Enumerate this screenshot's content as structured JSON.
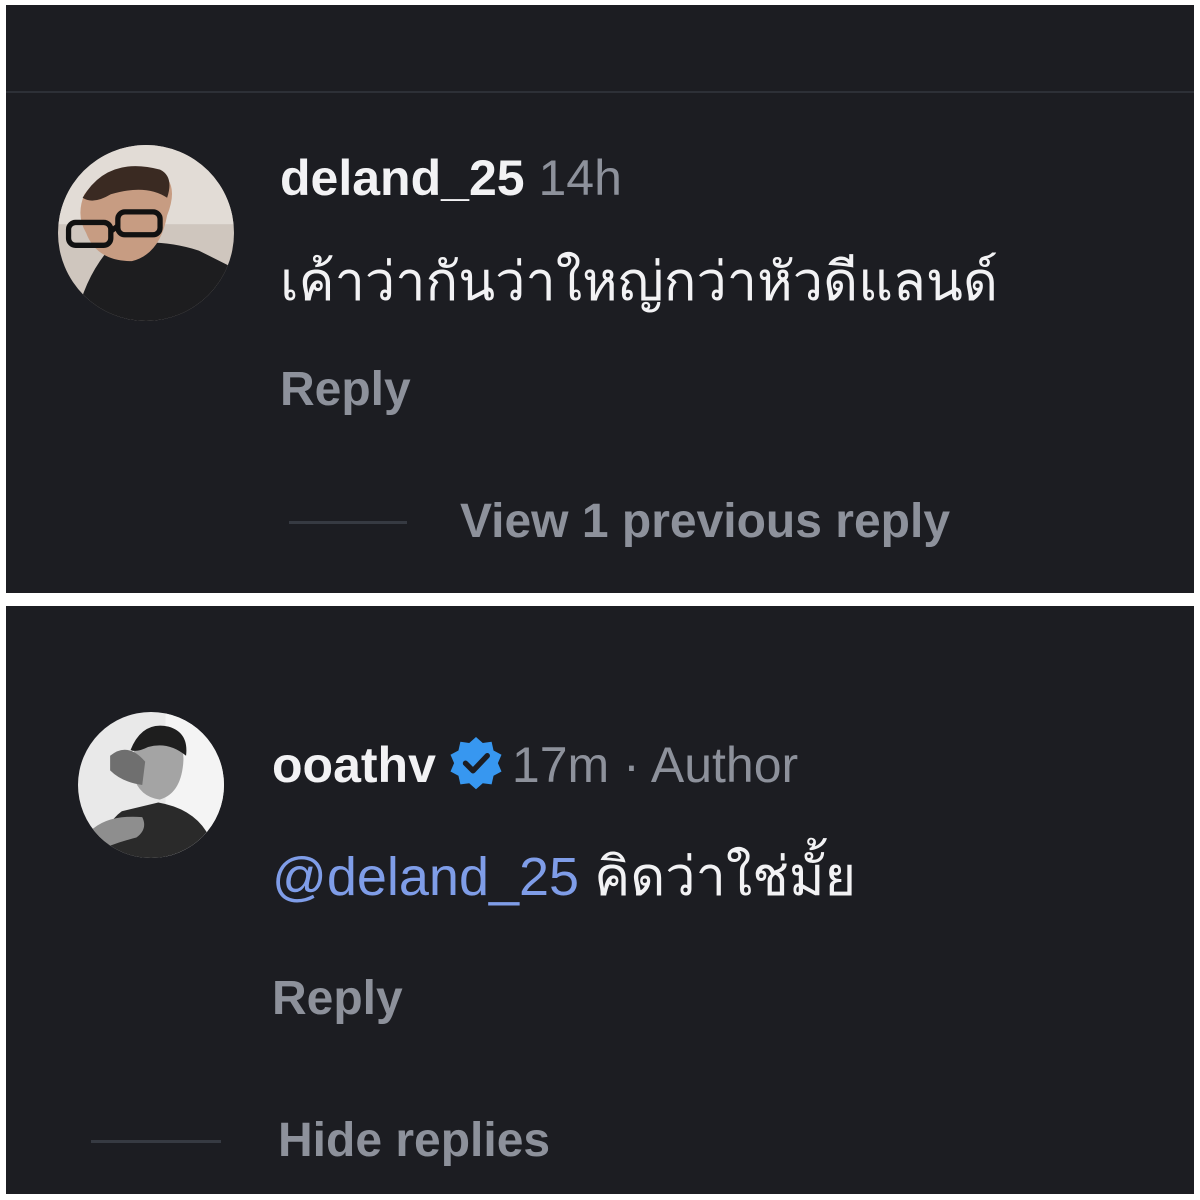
{
  "comments": [
    {
      "username": "deland_25",
      "time": "14h",
      "text": "เค้าว่ากันว่าใหญ่กว่าหัวดีแลนด์",
      "reply_label": "Reply",
      "thread_toggle_label": "View 1 previous reply"
    },
    {
      "username": "ooathv",
      "verified": true,
      "time": "17m",
      "separator": "·",
      "author_badge": "Author",
      "mention": "@deland_25",
      "text": "คิดว่าใช่มั้ย",
      "reply_label": "Reply",
      "thread_toggle_label": "Hide replies"
    }
  ],
  "colors": {
    "background": "#1c1d22",
    "username": "#f2f2f4",
    "meta": "#8d919b",
    "mention": "#7f9de8",
    "verified_badge": "#3797f0",
    "divider": "#363a42"
  },
  "icons": {
    "verified": "verified-badge-icon"
  }
}
